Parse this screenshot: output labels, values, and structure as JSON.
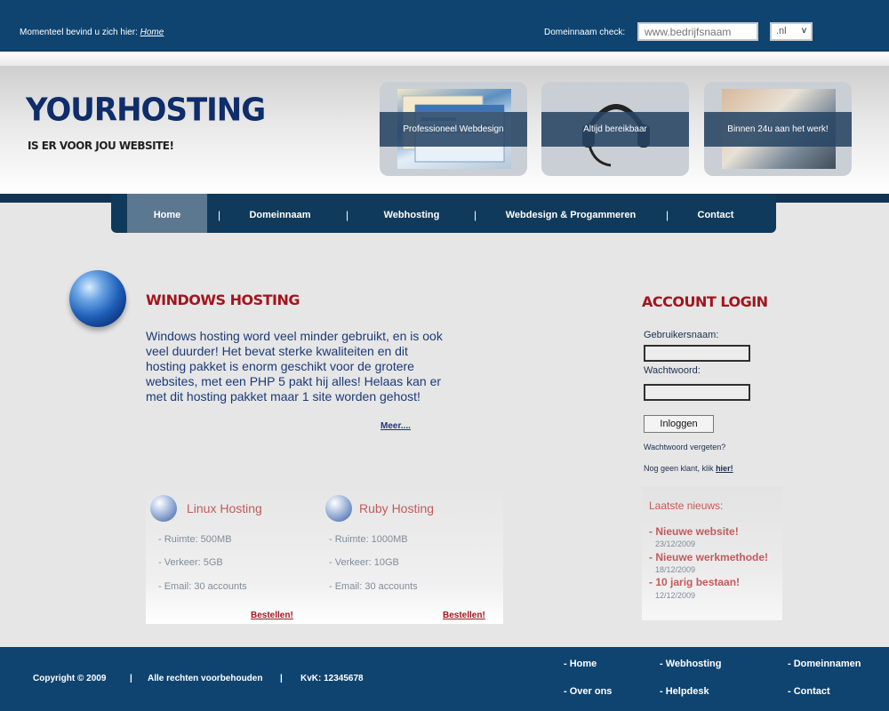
{
  "topbar": {
    "breadcrumb_prefix": "Momenteel bevind u zich hier:",
    "breadcrumb_link": "Home",
    "domain_check_label": "Domeinnaam check:",
    "domain_placeholder": "www.bedrijfsnaam",
    "tld_value": ".nl"
  },
  "header": {
    "logo": "YOURHOSTING",
    "slogan": "IS ER VOOR JOU WEBSITE!",
    "features": [
      "Professioneel Webdesign",
      "Altijd bereikbaar",
      "Binnen 24u aan het werk!"
    ]
  },
  "nav": {
    "items": [
      "Home",
      "Domeinnaam",
      "Webhosting",
      "Webdesign & Progammeren",
      "Contact"
    ],
    "separator": "|"
  },
  "main": {
    "title": "WINDOWS HOSTING",
    "intro": "Windows hosting word veel minder gebruikt, en is ook veel duurder! Het bevat sterke kwaliteiten en dit hosting pakket is enorm geschikt voor de grotere websites, met een PHP 5 pakt hij alles! Helaas kan er met dit hosting pakket maar 1 site worden gehost!",
    "more_link": "Meer....",
    "plans": [
      {
        "title": "Linux Hosting",
        "lines": [
          "- Ruimte:  500MB",
          "- Verkeer: 5GB",
          "- Email: 30 accounts"
        ],
        "order": "Bestellen!"
      },
      {
        "title": "Ruby Hosting",
        "lines": [
          "- Ruimte:  1000MB",
          "- Verkeer: 10GB",
          "- Email: 30 accounts"
        ],
        "order": "Bestellen!"
      }
    ]
  },
  "login": {
    "title": "ACCOUNT LOGIN",
    "username_label": "Gebruikersnaam:",
    "password_label": "Wachtwoord:",
    "button": "Inloggen",
    "forgot": "Wachtwoord vergeten?",
    "no_client_prefix": "Nog geen klant, klik",
    "no_client_link": "hier!"
  },
  "news": {
    "title": "Laatste nieuws:",
    "items": [
      {
        "title": "- Nieuwe website!",
        "date": "23/12/2009"
      },
      {
        "title": "- Nieuwe werkmethode!",
        "date": "18/12/2009"
      },
      {
        "title": "- 10 jarig bestaan!",
        "date": "12/12/2009"
      }
    ]
  },
  "footer": {
    "copyright": "Copyright © 2009",
    "rights": "Alle rechten voorbehouden",
    "kvk": "KvK: 12345678",
    "separator": "|",
    "links": [
      "- Home",
      "- Webhosting",
      "- Domeinnamen",
      "- Over ons",
      "- Helpdesk",
      "- Contact"
    ]
  }
}
